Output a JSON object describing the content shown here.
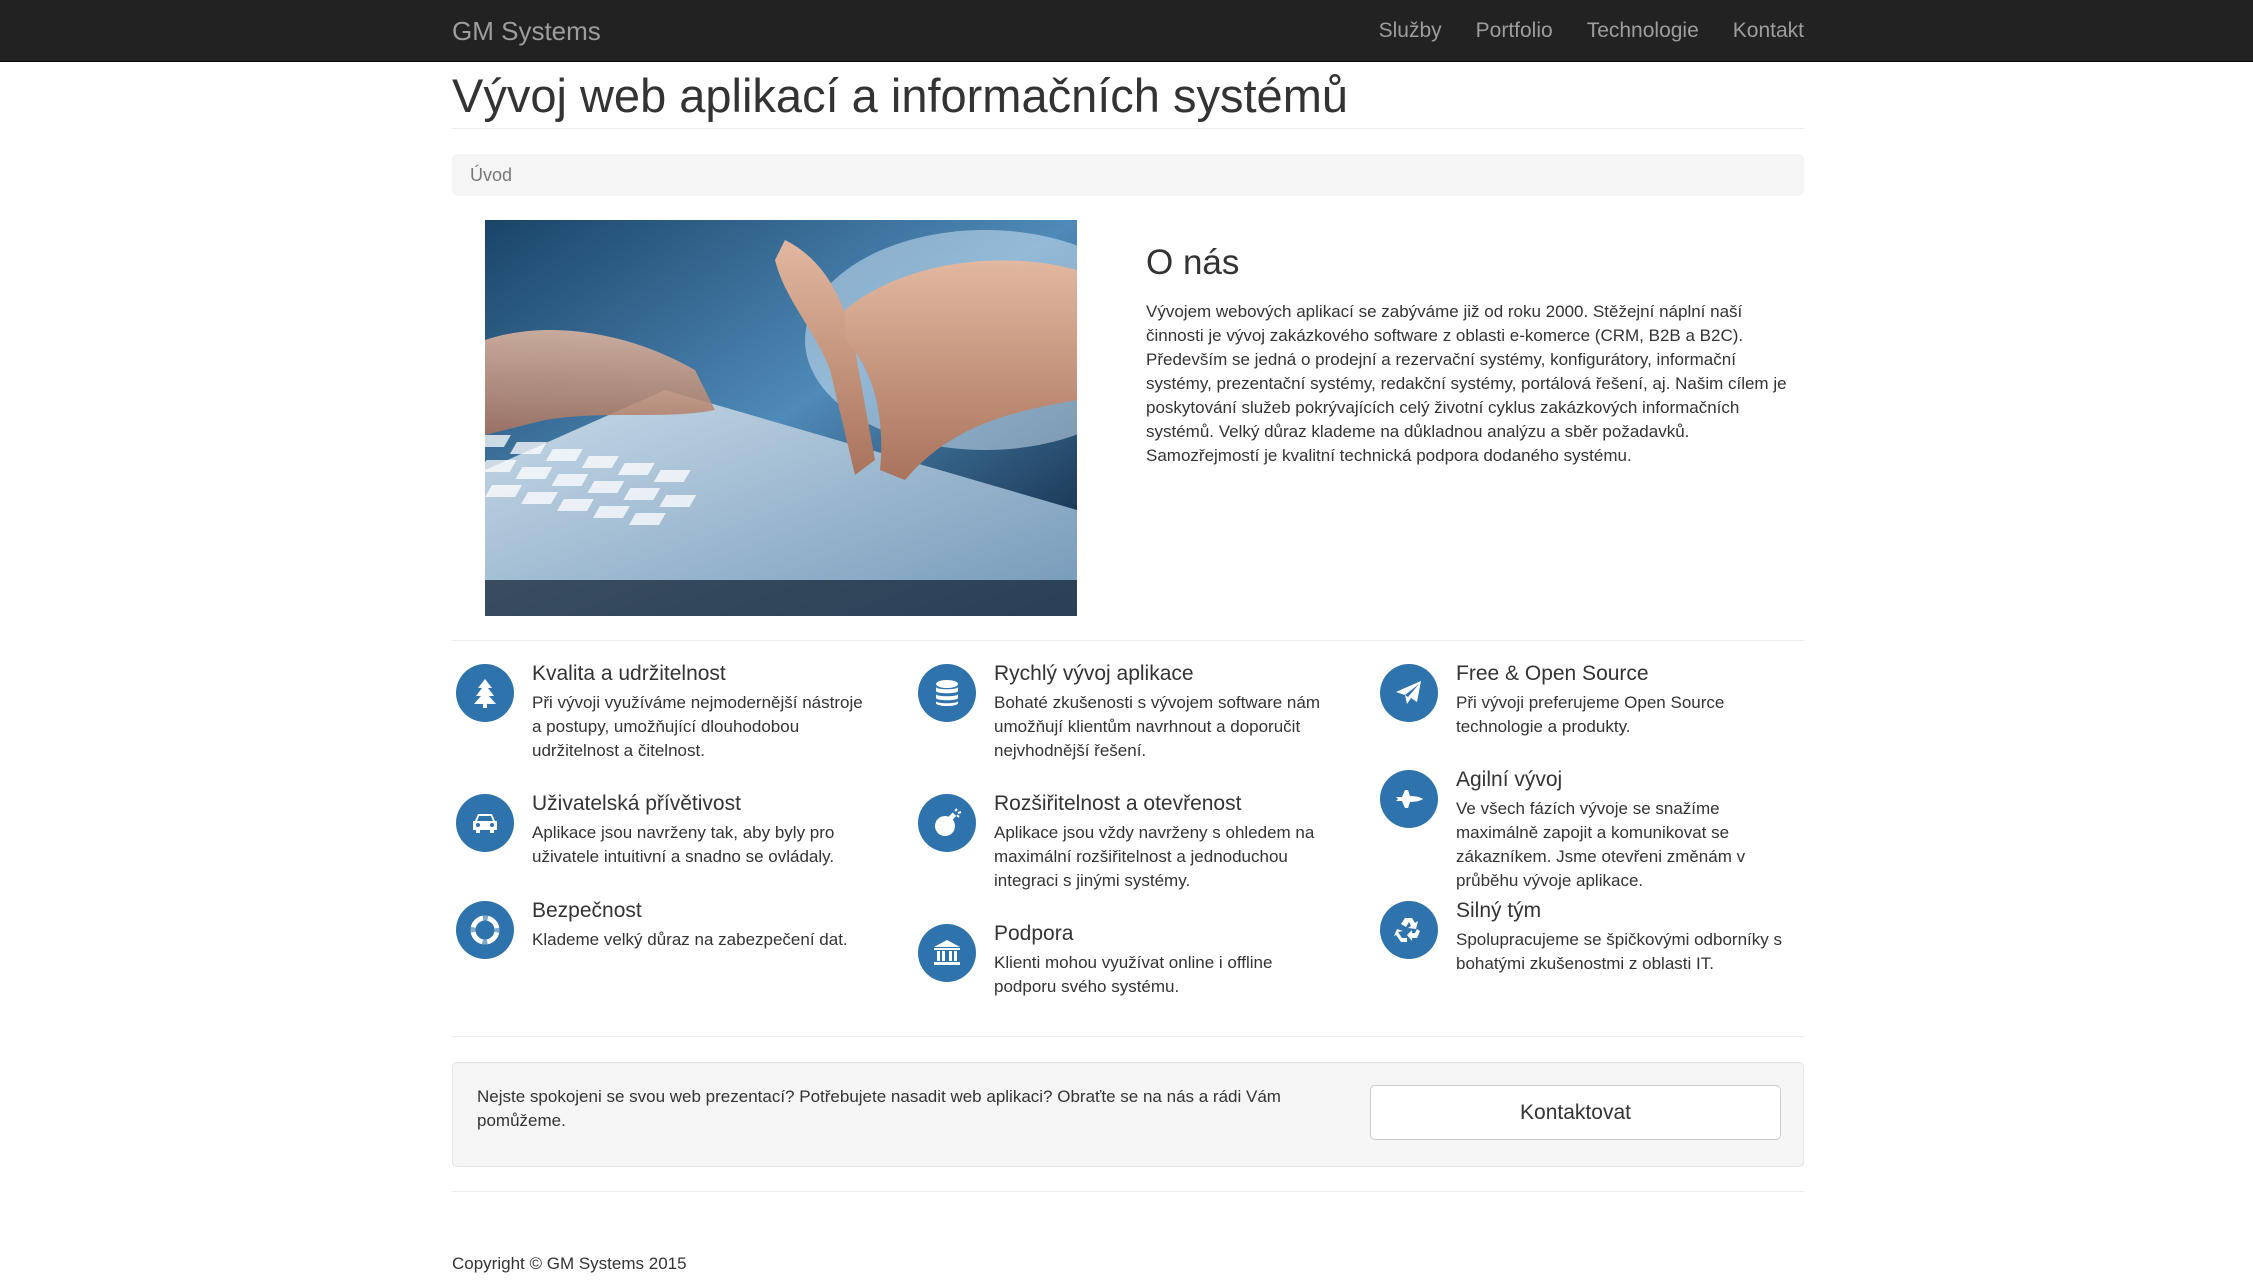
{
  "navbar": {
    "brand": "GM Systems",
    "links": [
      "Služby",
      "Portfolio",
      "Technologie",
      "Kontakt"
    ]
  },
  "page": {
    "title": "Vývoj web aplikací a informačních systémů",
    "breadcrumb": "Úvod"
  },
  "about": {
    "heading": "O nás",
    "text": "Vývojem webových aplikací se zabýváme již od roku 2000. Stěžejní náplní naší činnosti je vývoj zakázkového software z oblasti e-komerce (CRM, B2B a B2C). Především se jedná o prodejní a rezervační systémy, konfigurátory, informační systémy, prezentační systémy, redakční systémy, portálová řešení, aj. Našim cílem je poskytování služeb pokrývajících celý životní cyklus zakázkových informačních systémů. Velký důraz klademe na důkladnou analýzu a sběr požadavků. Samozřejmostí je kvalitní technická podpora dodaného systému."
  },
  "features": [
    {
      "icon": "tree-icon",
      "title": "Kvalita a udržitelnost",
      "text": "Při vývoji využíváme nejmodernější nástroje a postupy, umožňující dlouhodobou udržitelnost a čitelnost."
    },
    {
      "icon": "database-icon",
      "title": "Rychlý vývoj aplikace",
      "text": "Bohaté zkušenosti s vývojem software nám umožňují klientům navrhnout a doporučit nejvhodnější řešení."
    },
    {
      "icon": "paper-plane-icon",
      "title": "Free & Open Source",
      "text": "Při vývoji preferujeme Open Source technologie a produkty."
    },
    {
      "icon": "car-icon",
      "title": "Uživatelská přívětivost",
      "text": "Aplikace jsou navrženy tak, aby byly pro uživatele intuitivní a snadno se ovládaly."
    },
    {
      "icon": "bomb-icon",
      "title": "Rozšiřitelnost a otevřenost",
      "text": "Aplikace jsou vždy navrženy s ohledem na maximální rozšiřitelnost a jednoduchou integraci s jinými systémy."
    },
    {
      "icon": "space-shuttle-icon",
      "title": "Agilní vývoj",
      "text": "Ve všech fázích vývoje se snažíme maximálně zapojit a komunikovat se zákazníkem. Jsme otevřeni změnám v průběhu vývoje aplikace."
    },
    {
      "icon": "life-ring-icon",
      "title": "Bezpečnost",
      "text": "Klademe velký důraz na zabezpečení dat."
    },
    {
      "icon": "bank-icon",
      "title": "Podpora",
      "text": "Klienti mohou využívat online i offline podporu svého systému."
    },
    {
      "icon": "recycle-icon",
      "title": "Silný tým",
      "text": "Spolupracujeme se špičkovými odborníky s bohatými zkušenostmi z oblasti IT."
    }
  ],
  "cta": {
    "text": "Nejste spokojeni se svou web prezentací? Potřebujete nasadit web aplikaci? Obraťte se na nás a rádi Vám pomůžeme.",
    "button": "Kontaktovat"
  },
  "footer": {
    "copyright": "Copyright © GM Systems 2015"
  },
  "colors": {
    "navbar": "#222222",
    "icon_circle": "#2f73ad"
  }
}
